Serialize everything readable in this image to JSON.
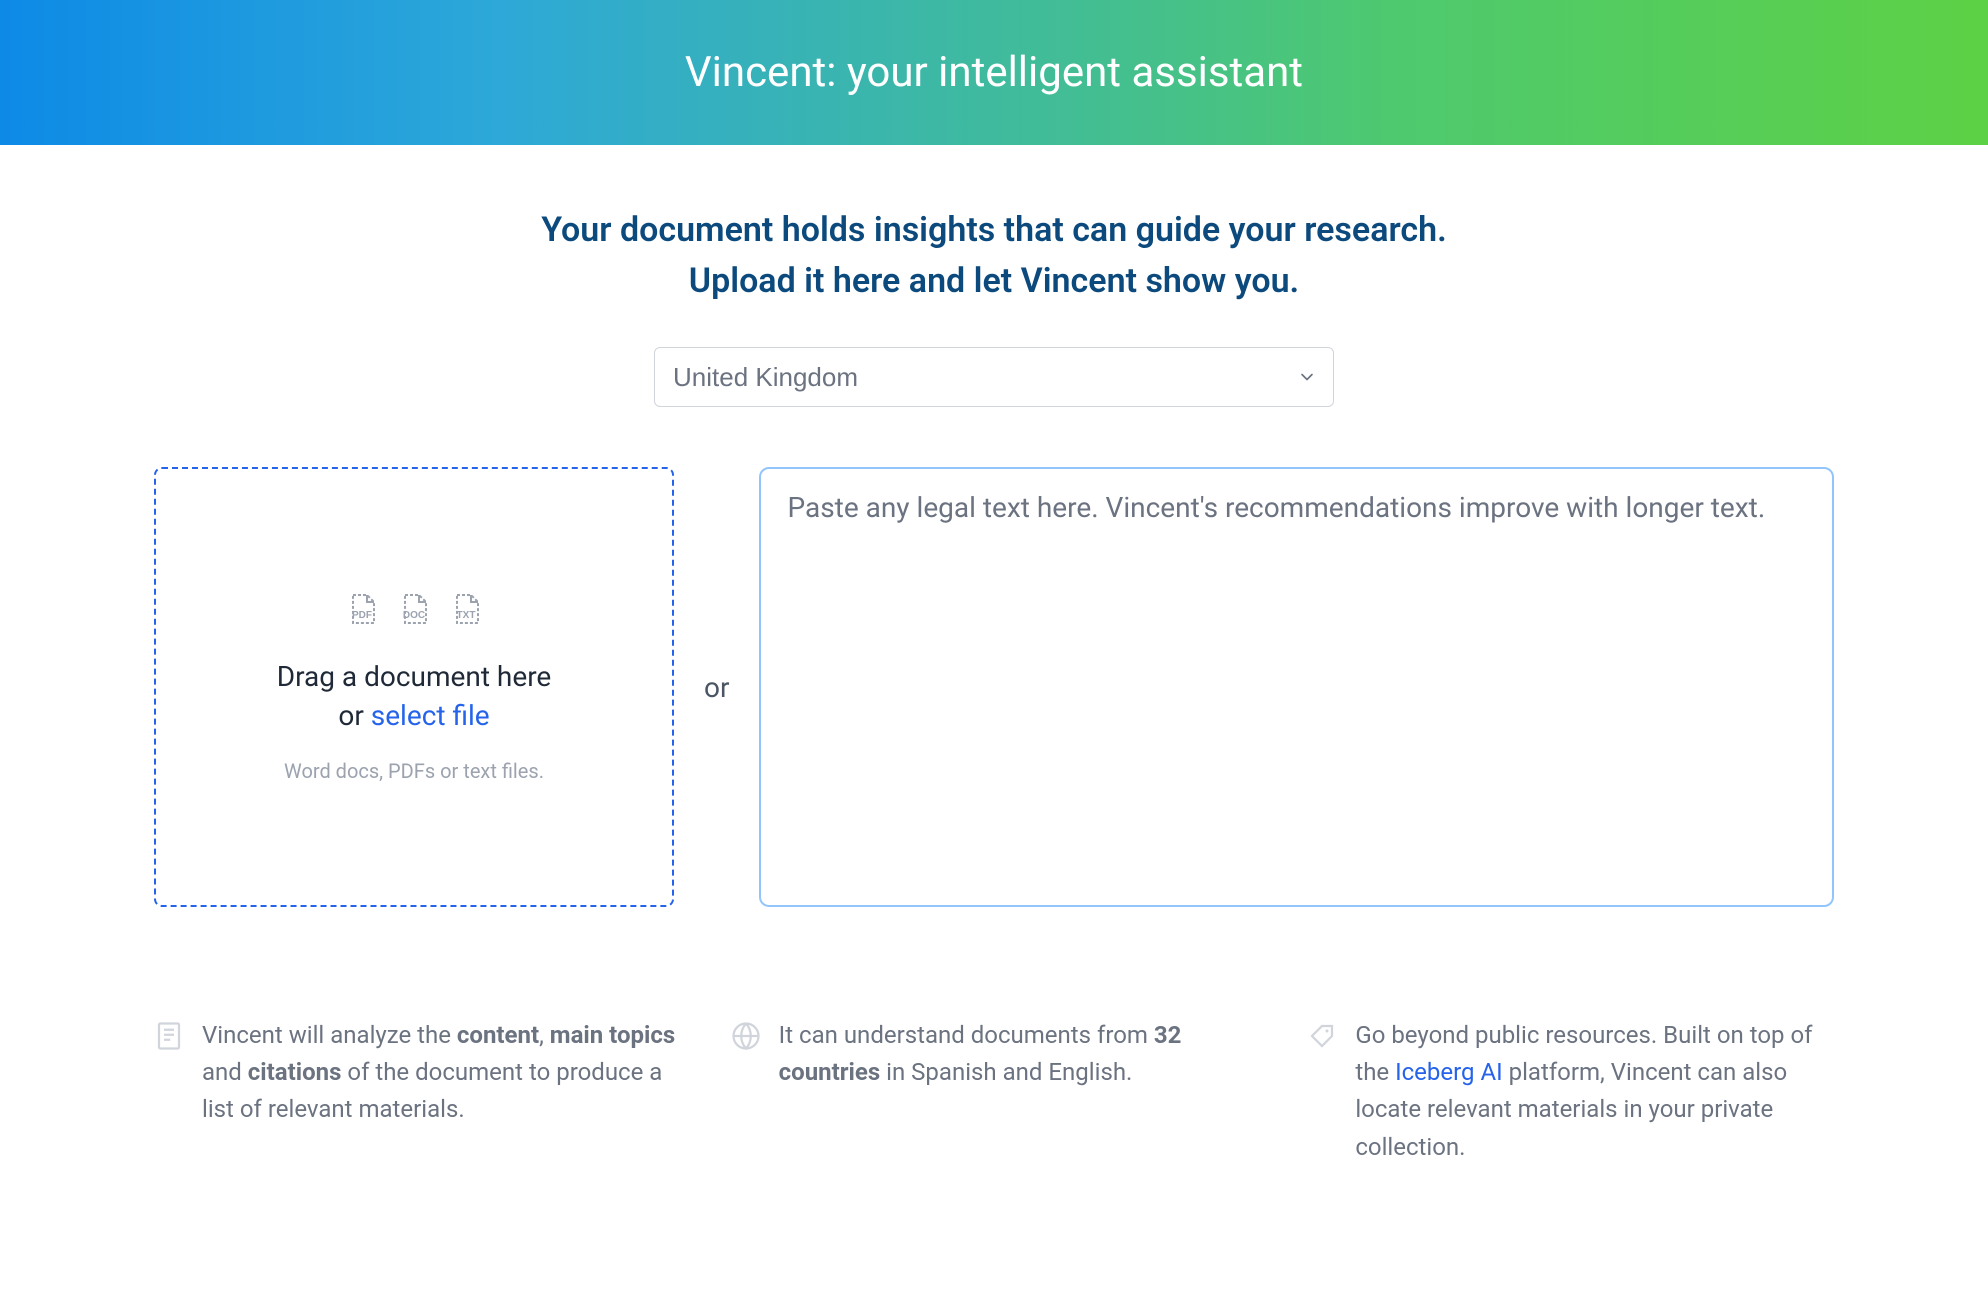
{
  "header": {
    "title": "Vincent: your intelligent assistant"
  },
  "intro": {
    "line1": "Your document holds insights that can guide your research.",
    "line2": "Upload it here and let Vincent show you."
  },
  "country_select": {
    "selected": "United Kingdom"
  },
  "dropzone": {
    "drag_text": "Drag a document here",
    "or_text": "or ",
    "select_file_text": "select file",
    "hint": "Word docs, PDFs or text files.",
    "icons": [
      "PDF",
      "DOC",
      "TXT"
    ]
  },
  "divider": {
    "or": "or"
  },
  "textarea": {
    "placeholder": "Paste any legal text here. Vincent's recommendations improve with longer text."
  },
  "features": [
    {
      "prefix": "Vincent will analyze the ",
      "b1": "content",
      "mid1": ", ",
      "b2": "main topics",
      "mid2": " and ",
      "b3": "citations",
      "suffix": " of the document to produce a list of relevant materials."
    },
    {
      "prefix": "It can understand documents from ",
      "b1": "32 countries",
      "suffix": " in Spanish and English."
    },
    {
      "prefix": "Go beyond public resources. Built on top of the ",
      "link": "Iceberg AI",
      "suffix": " platform, Vincent can also locate relevant materials in your private collection."
    }
  ]
}
